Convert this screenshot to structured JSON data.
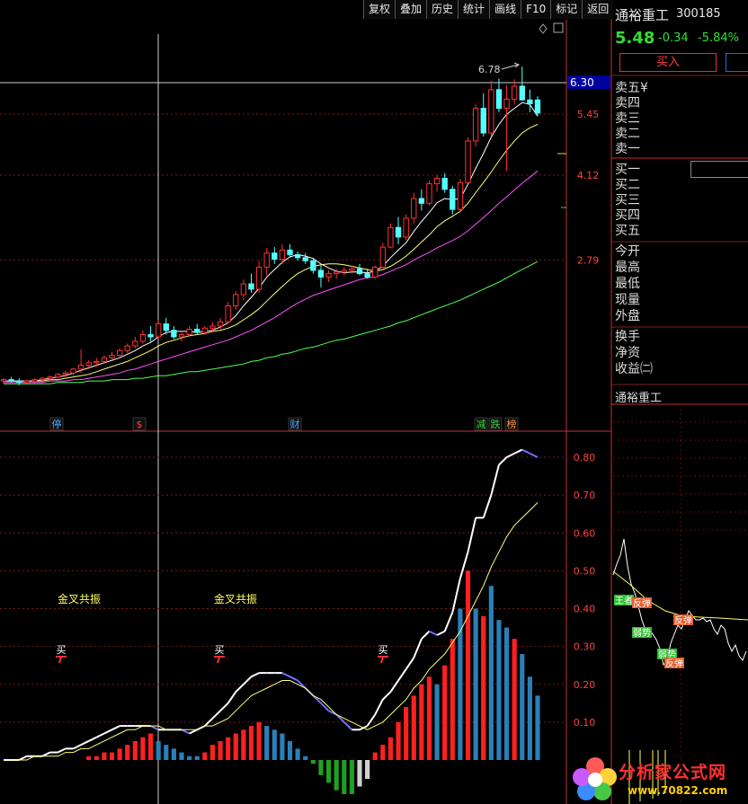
{
  "toolbar": {
    "buttons": [
      "复权",
      "叠加",
      "历史",
      "统计",
      "画线",
      "F10",
      "标记",
      "返回"
    ]
  },
  "stock": {
    "name": "通裕重工",
    "code": "300185",
    "price": "5.48",
    "change": "-0.34",
    "change_pct": "-5.84%",
    "buy_label": "买入"
  },
  "order_book": {
    "sell": [
      "卖五",
      "卖四",
      "卖三",
      "卖二",
      "卖一"
    ],
    "sell5_suffix": "¥",
    "buy": [
      "买一",
      "买二",
      "买三",
      "买四",
      "买五"
    ]
  },
  "stats": [
    "今开",
    "最高",
    "最低",
    "现量",
    "外盘"
  ],
  "stats2": [
    "换手",
    "净资",
    "收益㈡"
  ],
  "intraday_title": "通裕重工",
  "intraday_tags": [
    "王者",
    "反弹",
    "弱势",
    "反弹",
    "弱势",
    "反弹"
  ],
  "price_axis": {
    "labels": [
      "6.30",
      "5.45",
      "4.12",
      "2.79"
    ],
    "cursor_price": "6.30"
  },
  "peak_label": "6.78",
  "event_tags": [
    {
      "text": "停",
      "color": "#4aa8ff"
    },
    {
      "text": "$",
      "color": "#ff4040"
    },
    {
      "text": "财",
      "color": "#4aa8ff"
    },
    {
      "text": "减",
      "color": "#40d040"
    },
    {
      "text": "跌",
      "color": "#40d040"
    },
    {
      "text": "榜",
      "color": "#ff9040"
    }
  ],
  "indicator_axis": [
    "0.80",
    "0.70",
    "0.60",
    "0.50",
    "0.40",
    "0.30",
    "0.20",
    "0.10"
  ],
  "signals": {
    "golden_cross": "金叉共振",
    "buy": "买"
  },
  "watermark": {
    "brand": "分析家公式网",
    "url": "www.70822.com"
  },
  "colors": {
    "up": "#ff3232",
    "down": "#54ffff",
    "ma5": "#ffffff",
    "ma10": "#ffff78",
    "ma20": "#ff50ff",
    "ma60": "#50ff50",
    "hist_pos": "#ff2020",
    "hist_fade": "#2a7fb8",
    "hist_neg": "#20a020"
  },
  "chart_data": {
    "type": "candlestick",
    "price_ylim": [
      1.45,
      6.9
    ],
    "candles": [
      [
        1.6,
        1.62,
        1.58,
        1.61
      ],
      [
        1.61,
        1.63,
        1.59,
        1.6
      ],
      [
        1.6,
        1.62,
        1.57,
        1.59
      ],
      [
        1.59,
        1.61,
        1.58,
        1.6
      ],
      [
        1.6,
        1.62,
        1.59,
        1.61
      ],
      [
        1.61,
        1.63,
        1.6,
        1.62
      ],
      [
        1.62,
        1.64,
        1.6,
        1.63
      ],
      [
        1.63,
        1.66,
        1.62,
        1.65
      ],
      [
        1.65,
        1.68,
        1.63,
        1.66
      ],
      [
        1.66,
        1.7,
        1.64,
        1.69
      ],
      [
        1.69,
        1.85,
        1.66,
        1.72
      ],
      [
        1.72,
        1.76,
        1.69,
        1.74
      ],
      [
        1.74,
        1.78,
        1.71,
        1.75
      ],
      [
        1.75,
        1.8,
        1.73,
        1.78
      ],
      [
        1.78,
        1.83,
        1.76,
        1.8
      ],
      [
        1.8,
        1.86,
        1.78,
        1.84
      ],
      [
        1.84,
        1.9,
        1.82,
        1.88
      ],
      [
        1.88,
        1.96,
        1.86,
        1.92
      ],
      [
        1.92,
        2.02,
        1.9,
        1.98
      ],
      [
        1.98,
        2.06,
        1.92,
        1.96
      ],
      [
        1.96,
        2.12,
        1.94,
        2.08
      ],
      [
        2.08,
        2.14,
        1.98,
        2.02
      ],
      [
        2.02,
        2.06,
        1.94,
        1.96
      ],
      [
        1.96,
        2.0,
        1.92,
        1.98
      ],
      [
        1.98,
        2.06,
        1.96,
        2.03
      ],
      [
        2.03,
        2.08,
        1.98,
        2.0
      ],
      [
        2.0,
        2.06,
        1.98,
        2.04
      ],
      [
        2.04,
        2.1,
        2.0,
        2.06
      ],
      [
        2.06,
        2.14,
        2.03,
        2.1
      ],
      [
        2.1,
        2.3,
        2.08,
        2.26
      ],
      [
        2.26,
        2.42,
        2.22,
        2.38
      ],
      [
        2.38,
        2.55,
        2.32,
        2.5
      ],
      [
        2.5,
        2.62,
        2.4,
        2.44
      ],
      [
        2.44,
        2.78,
        2.4,
        2.7
      ],
      [
        2.7,
        2.95,
        2.6,
        2.88
      ],
      [
        2.88,
        2.96,
        2.74,
        2.8
      ],
      [
        2.8,
        3.0,
        2.74,
        2.92
      ],
      [
        2.92,
        3.0,
        2.82,
        2.86
      ],
      [
        2.86,
        2.9,
        2.78,
        2.82
      ],
      [
        2.82,
        2.88,
        2.74,
        2.78
      ],
      [
        2.78,
        2.82,
        2.62,
        2.66
      ],
      [
        2.66,
        2.72,
        2.46,
        2.58
      ],
      [
        2.58,
        2.66,
        2.52,
        2.62
      ],
      [
        2.62,
        2.68,
        2.56,
        2.64
      ],
      [
        2.64,
        2.7,
        2.6,
        2.66
      ],
      [
        2.66,
        2.72,
        2.62,
        2.68
      ],
      [
        2.68,
        2.74,
        2.6,
        2.62
      ],
      [
        2.62,
        2.68,
        2.56,
        2.58
      ],
      [
        2.58,
        2.72,
        2.56,
        2.7
      ],
      [
        2.7,
        3.02,
        2.68,
        2.96
      ],
      [
        2.96,
        3.3,
        2.94,
        3.24
      ],
      [
        3.24,
        3.4,
        3.0,
        3.1
      ],
      [
        3.1,
        3.44,
        3.06,
        3.38
      ],
      [
        3.38,
        3.8,
        3.3,
        3.7
      ],
      [
        3.7,
        3.86,
        3.5,
        3.62
      ],
      [
        3.62,
        4.02,
        3.58,
        3.96
      ],
      [
        3.96,
        4.12,
        3.82,
        4.06
      ],
      [
        4.06,
        4.16,
        3.8,
        3.86
      ],
      [
        3.86,
        3.92,
        3.44,
        3.52
      ],
      [
        3.52,
        4.05,
        3.48,
        3.98
      ],
      [
        3.98,
        4.9,
        3.96,
        4.82
      ],
      [
        4.82,
        5.7,
        4.7,
        5.6
      ],
      [
        5.6,
        6.0,
        4.92,
        5.0
      ],
      [
        5.0,
        6.36,
        4.92,
        6.1
      ],
      [
        6.1,
        6.42,
        5.5,
        5.6
      ],
      [
        5.6,
        6.22,
        4.2,
        5.84
      ],
      [
        5.84,
        6.4,
        5.7,
        6.2
      ],
      [
        6.2,
        6.78,
        5.8,
        5.82
      ],
      [
        5.82,
        6.1,
        5.5,
        5.72
      ],
      [
        5.82,
        5.92,
        5.4,
        5.48
      ]
    ],
    "ma5": [
      1.6,
      1.6,
      1.6,
      1.6,
      1.6,
      1.61,
      1.62,
      1.63,
      1.64,
      1.66,
      1.68,
      1.7,
      1.72,
      1.74,
      1.76,
      1.78,
      1.81,
      1.84,
      1.88,
      1.91,
      1.96,
      2.0,
      2.01,
      2.01,
      2.01,
      2.0,
      2.01,
      2.02,
      2.05,
      2.09,
      2.16,
      2.26,
      2.35,
      2.45,
      2.58,
      2.67,
      2.76,
      2.83,
      2.86,
      2.84,
      2.81,
      2.74,
      2.69,
      2.65,
      2.63,
      2.64,
      2.64,
      2.63,
      2.65,
      2.71,
      2.82,
      2.92,
      3.02,
      3.18,
      3.33,
      3.47,
      3.63,
      3.7,
      3.68,
      3.7,
      3.95,
      4.25,
      4.55,
      4.9,
      5.2,
      5.45,
      5.6,
      5.75,
      5.7,
      5.4
    ],
    "ma10": [
      1.6,
      1.6,
      1.6,
      1.6,
      1.6,
      1.6,
      1.61,
      1.61,
      1.62,
      1.63,
      1.64,
      1.65,
      1.67,
      1.69,
      1.71,
      1.73,
      1.75,
      1.78,
      1.81,
      1.84,
      1.88,
      1.91,
      1.93,
      1.95,
      1.97,
      1.98,
      1.99,
      2.01,
      2.02,
      2.04,
      2.07,
      2.12,
      2.17,
      2.23,
      2.31,
      2.39,
      2.47,
      2.55,
      2.62,
      2.67,
      2.71,
      2.73,
      2.74,
      2.74,
      2.73,
      2.71,
      2.69,
      2.67,
      2.65,
      2.67,
      2.71,
      2.77,
      2.84,
      2.93,
      3.03,
      3.13,
      3.25,
      3.34,
      3.41,
      3.49,
      3.62,
      3.8,
      3.98,
      4.18,
      4.4,
      4.62,
      4.82,
      5.0,
      5.12,
      5.2
    ],
    "ma20": [
      1.59,
      1.59,
      1.59,
      1.59,
      1.59,
      1.59,
      1.6,
      1.6,
      1.6,
      1.61,
      1.61,
      1.62,
      1.63,
      1.64,
      1.65,
      1.66,
      1.68,
      1.69,
      1.71,
      1.73,
      1.75,
      1.77,
      1.79,
      1.81,
      1.83,
      1.85,
      1.87,
      1.89,
      1.91,
      1.93,
      1.96,
      1.99,
      2.02,
      2.06,
      2.1,
      2.14,
      2.19,
      2.24,
      2.29,
      2.33,
      2.37,
      2.4,
      2.43,
      2.46,
      2.49,
      2.52,
      2.55,
      2.57,
      2.58,
      2.61,
      2.65,
      2.69,
      2.73,
      2.79,
      2.84,
      2.89,
      2.95,
      3.0,
      3.05,
      3.11,
      3.19,
      3.29,
      3.39,
      3.5,
      3.62,
      3.73,
      3.85,
      3.97,
      4.08,
      4.2
    ],
    "ma60": [
      1.58,
      1.58,
      1.58,
      1.58,
      1.58,
      1.58,
      1.58,
      1.59,
      1.59,
      1.59,
      1.59,
      1.6,
      1.6,
      1.6,
      1.61,
      1.61,
      1.61,
      1.62,
      1.62,
      1.63,
      1.64,
      1.64,
      1.65,
      1.66,
      1.67,
      1.67,
      1.68,
      1.69,
      1.7,
      1.71,
      1.72,
      1.73,
      1.75,
      1.76,
      1.78,
      1.79,
      1.81,
      1.82,
      1.84,
      1.86,
      1.87,
      1.89,
      1.91,
      1.93,
      1.94,
      1.96,
      1.98,
      2.0,
      2.02,
      2.04,
      2.06,
      2.09,
      2.11,
      2.14,
      2.17,
      2.2,
      2.23,
      2.26,
      2.29,
      2.32,
      2.36,
      2.4,
      2.44,
      2.48,
      2.52,
      2.57,
      2.62,
      2.67,
      2.72,
      2.77
    ],
    "indicator_ylim": [
      -0.12,
      0.86
    ],
    "ind_white": [
      0.0,
      0.0,
      0.0,
      0.01,
      0.01,
      0.01,
      0.02,
      0.02,
      0.03,
      0.03,
      0.04,
      0.05,
      0.06,
      0.07,
      0.08,
      0.09,
      0.09,
      0.09,
      0.09,
      0.09,
      0.08,
      0.08,
      0.08,
      0.08,
      0.07,
      0.08,
      0.09,
      0.11,
      0.13,
      0.15,
      0.18,
      0.2,
      0.22,
      0.23,
      0.23,
      0.23,
      0.23,
      0.22,
      0.21,
      0.19,
      0.17,
      0.15,
      0.13,
      0.12,
      0.1,
      0.08,
      0.08,
      0.09,
      0.12,
      0.16,
      0.18,
      0.21,
      0.24,
      0.27,
      0.32,
      0.34,
      0.33,
      0.34,
      0.39,
      0.48,
      0.55,
      0.64,
      0.64,
      0.7,
      0.78,
      0.8,
      0.81,
      0.82,
      0.81,
      0.8
    ],
    "ind_yellow": [
      0.0,
      0.0,
      0.0,
      0.0,
      0.01,
      0.01,
      0.01,
      0.01,
      0.02,
      0.02,
      0.03,
      0.03,
      0.04,
      0.05,
      0.06,
      0.07,
      0.08,
      0.08,
      0.09,
      0.09,
      0.09,
      0.08,
      0.08,
      0.08,
      0.08,
      0.08,
      0.09,
      0.09,
      0.1,
      0.11,
      0.13,
      0.15,
      0.17,
      0.18,
      0.19,
      0.2,
      0.21,
      0.21,
      0.2,
      0.19,
      0.17,
      0.16,
      0.14,
      0.12,
      0.11,
      0.1,
      0.09,
      0.08,
      0.09,
      0.1,
      0.12,
      0.14,
      0.16,
      0.19,
      0.21,
      0.24,
      0.26,
      0.28,
      0.31,
      0.34,
      0.38,
      0.42,
      0.46,
      0.51,
      0.55,
      0.59,
      0.62,
      0.64,
      0.66,
      0.68
    ],
    "histogram": [
      0.0,
      0.0,
      0.0,
      0.0,
      0.0,
      0.0,
      0.0,
      0.0,
      0.0,
      0.0,
      0.0,
      0.01,
      0.01,
      0.02,
      0.02,
      0.03,
      0.04,
      0.05,
      0.06,
      0.07,
      0.05,
      0.04,
      0.03,
      0.02,
      0.01,
      0.01,
      0.02,
      0.04,
      0.05,
      0.06,
      0.07,
      0.08,
      0.09,
      0.1,
      0.09,
      0.08,
      0.07,
      0.05,
      0.03,
      0.01,
      -0.01,
      -0.04,
      -0.06,
      -0.08,
      -0.09,
      -0.09,
      -0.07,
      -0.05,
      0.02,
      0.04,
      0.06,
      0.1,
      0.14,
      0.17,
      0.2,
      0.22,
      0.2,
      0.25,
      0.32,
      0.4,
      0.5,
      0.4,
      0.38,
      0.46,
      0.37,
      0.35,
      0.32,
      0.28,
      0.22,
      0.17
    ],
    "hist_fade_idx": [
      20,
      21,
      22,
      23,
      24,
      25,
      34,
      35,
      36,
      37,
      38,
      39,
      56,
      59,
      61,
      63,
      64,
      65,
      67,
      68,
      69
    ]
  }
}
